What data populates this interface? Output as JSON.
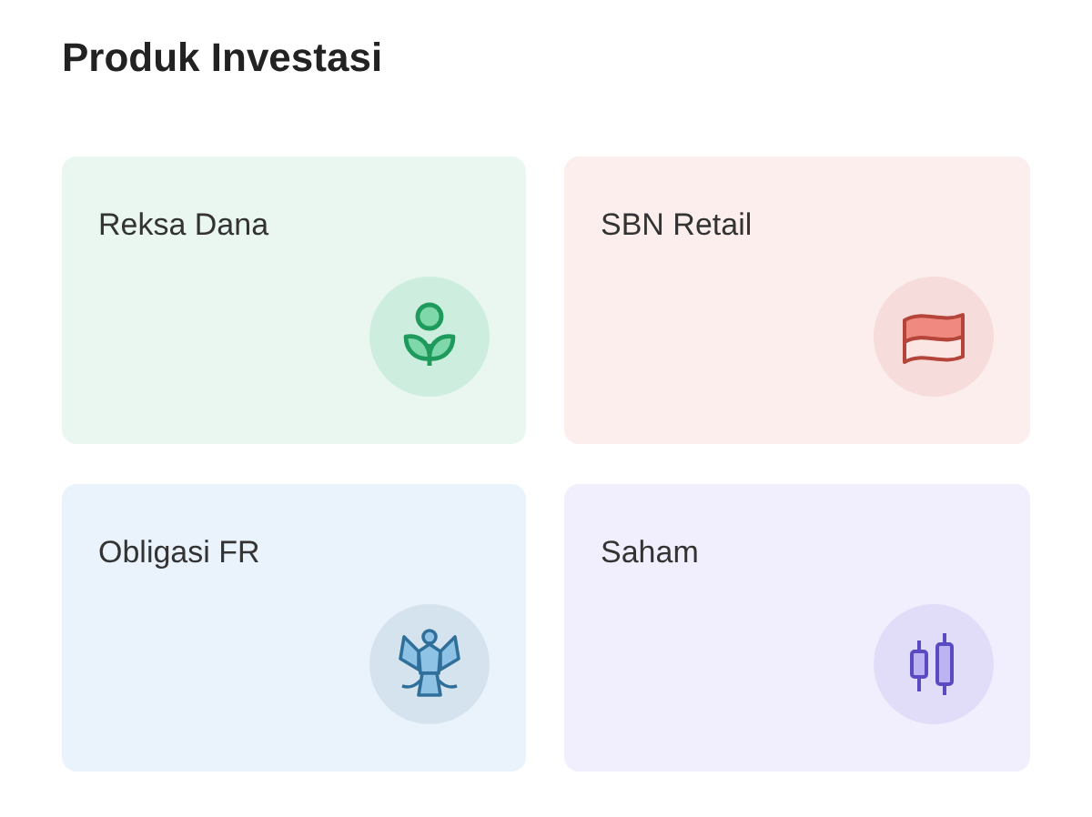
{
  "title": "Produk Investasi",
  "products": [
    {
      "label": "Reksa Dana",
      "kind": "plant",
      "color": "#eaf6f0"
    },
    {
      "label": "SBN Retail",
      "kind": "flag",
      "color": "#fbeeed"
    },
    {
      "label": "Obligasi FR",
      "kind": "eagle",
      "color": "#eaf2fb"
    },
    {
      "label": "Saham",
      "kind": "candles",
      "color": "#f1effd"
    }
  ]
}
